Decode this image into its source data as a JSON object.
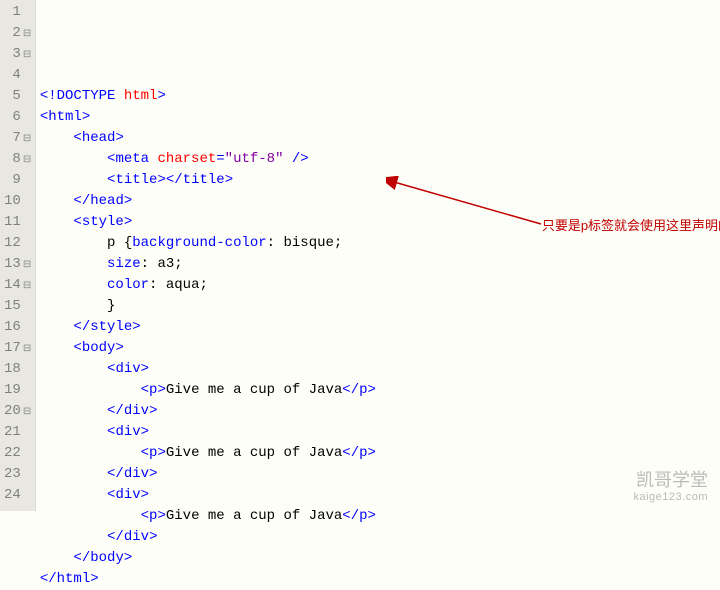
{
  "code": {
    "lines": [
      {
        "n": 1,
        "fold": "",
        "html": "<span class='blue'>&lt;!</span><span class='tag'>DOCTYPE</span> <span class='attr'>html</span><span class='blue'>&gt;</span>"
      },
      {
        "n": 2,
        "fold": "⊟",
        "html": "<span class='blue'>&lt;</span><span class='tag'>html</span><span class='blue'>&gt;</span>"
      },
      {
        "n": 3,
        "fold": "⊟",
        "html": "    <span class='blue'>&lt;</span><span class='tag'>head</span><span class='blue'>&gt;</span>"
      },
      {
        "n": 4,
        "fold": "",
        "html": "        <span class='blue'>&lt;</span><span class='tag'>meta</span> <span class='attr'>charset</span><span class='blue'>=</span><span class='str'>\"utf-8\"</span> <span class='blue'>/&gt;</span>"
      },
      {
        "n": 5,
        "fold": "",
        "html": "        <span class='blue'>&lt;</span><span class='tag'>title</span><span class='blue'>&gt;&lt;/</span><span class='tag'>title</span><span class='blue'>&gt;</span>"
      },
      {
        "n": 6,
        "fold": "",
        "html": "    <span class='blue'>&lt;/</span><span class='tag'>head</span><span class='blue'>&gt;</span>"
      },
      {
        "n": 7,
        "fold": "⊟",
        "html": "    <span class='blue'>&lt;</span><span class='tag'>style</span><span class='blue'>&gt;</span>"
      },
      {
        "n": 8,
        "fold": "⊟",
        "html": "        <span class='black'>p</span> <span class='black'>{</span><span class='kw'>background-color</span><span class='black'>:</span> <span class='black'>bisque;</span>"
      },
      {
        "n": 9,
        "fold": "",
        "html": "        <span class='kw'>size</span><span class='black'>:</span> <span class='black'>a3;</span>"
      },
      {
        "n": 10,
        "fold": "",
        "html": "        <span class='kw'>color</span><span class='black'>:</span> <span class='black'>aqua;</span>"
      },
      {
        "n": 11,
        "fold": "",
        "html": "        <span class='black'>}</span>"
      },
      {
        "n": 12,
        "fold": "",
        "html": "    <span class='blue'>&lt;/</span><span class='tag'>style</span><span class='blue'>&gt;</span>"
      },
      {
        "n": 13,
        "fold": "⊟",
        "html": "    <span class='blue'>&lt;</span><span class='tag'>body</span><span class='blue'>&gt;</span>"
      },
      {
        "n": 14,
        "fold": "⊟",
        "html": "        <span class='blue'>&lt;</span><span class='tag'>div</span><span class='blue'>&gt;</span>"
      },
      {
        "n": 15,
        "fold": "",
        "html": "            <span class='blue'>&lt;</span><span class='tag'>p</span><span class='blue'>&gt;</span><span class='black'>Give me a cup of Java</span><span class='blue'>&lt;/</span><span class='tag'>p</span><span class='blue'>&gt;</span>"
      },
      {
        "n": 16,
        "fold": "",
        "html": "        <span class='blue'>&lt;/</span><span class='tag'>div</span><span class='blue'>&gt;</span>"
      },
      {
        "n": 17,
        "fold": "⊟",
        "html": "        <span class='blue'>&lt;</span><span class='tag'>div</span><span class='blue'>&gt;</span>"
      },
      {
        "n": 18,
        "fold": "",
        "html": "            <span class='blue'>&lt;</span><span class='tag'>p</span><span class='blue'>&gt;</span><span class='black'>Give me a cup of Java</span><span class='blue'>&lt;/</span><span class='tag'>p</span><span class='blue'>&gt;</span>"
      },
      {
        "n": 19,
        "fold": "",
        "html": "        <span class='blue'>&lt;/</span><span class='tag'>div</span><span class='blue'>&gt;</span>"
      },
      {
        "n": 20,
        "fold": "⊟",
        "html": "        <span class='blue'>&lt;</span><span class='tag'>div</span><span class='blue'>&gt;</span>"
      },
      {
        "n": 21,
        "fold": "",
        "html": "            <span class='blue'>&lt;</span><span class='tag'>p</span><span class='blue'>&gt;</span><span class='black'>Give me a cup of Java</span><span class='blue'>&lt;/</span><span class='tag'>p</span><span class='blue'>&gt;</span>"
      },
      {
        "n": 22,
        "fold": "",
        "html": "        <span class='blue'>&lt;/</span><span class='tag'>div</span><span class='blue'>&gt;</span>"
      },
      {
        "n": 23,
        "fold": "",
        "html": "    <span class='blue'>&lt;/</span><span class='tag'>body</span><span class='blue'>&gt;</span>"
      },
      {
        "n": 24,
        "fold": "",
        "html": "<span class='blue'>&lt;/</span><span class='tag'>html</span><span class='blue'>&gt;</span>"
      }
    ]
  },
  "annotation": {
    "text": "只要是p标签就会使用这里声明的样式"
  },
  "watermark": {
    "title": "凯哥学堂",
    "url": "kaige123.com"
  }
}
